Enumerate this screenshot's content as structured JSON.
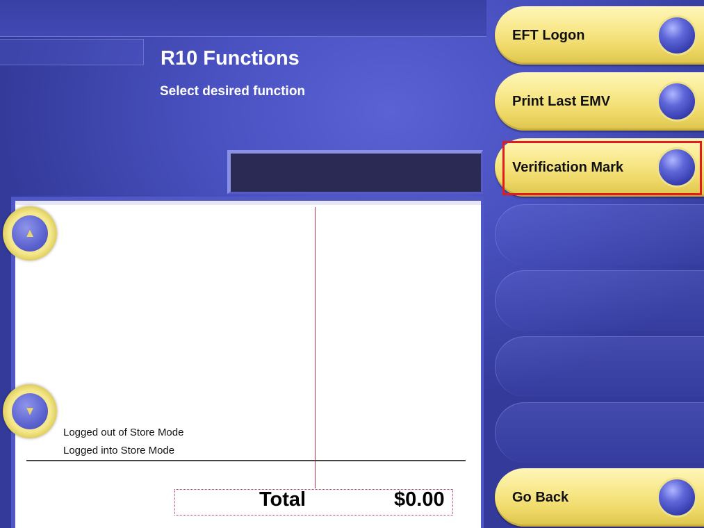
{
  "header": {
    "title": "R10 Functions",
    "subtitle": "Select desired function"
  },
  "receipt": {
    "log_lines": [
      "Logged out of Store Mode",
      "Logged into Store Mode"
    ],
    "total_label": "Total",
    "total_value": "$0.00"
  },
  "function_buttons": [
    {
      "label": "EFT Logon"
    },
    {
      "label": "Print Last EMV"
    },
    {
      "label": "Verification Mark"
    }
  ],
  "go_back": {
    "label": "Go Back"
  },
  "colors": {
    "background": "#3e45ad",
    "button_yellow": "#f8e88a",
    "highlight": "#e21c1c"
  },
  "icons": {
    "scroll_up": "triangle-up-icon",
    "scroll_down": "triangle-down-icon",
    "button_knob": "blue-circle-icon"
  }
}
